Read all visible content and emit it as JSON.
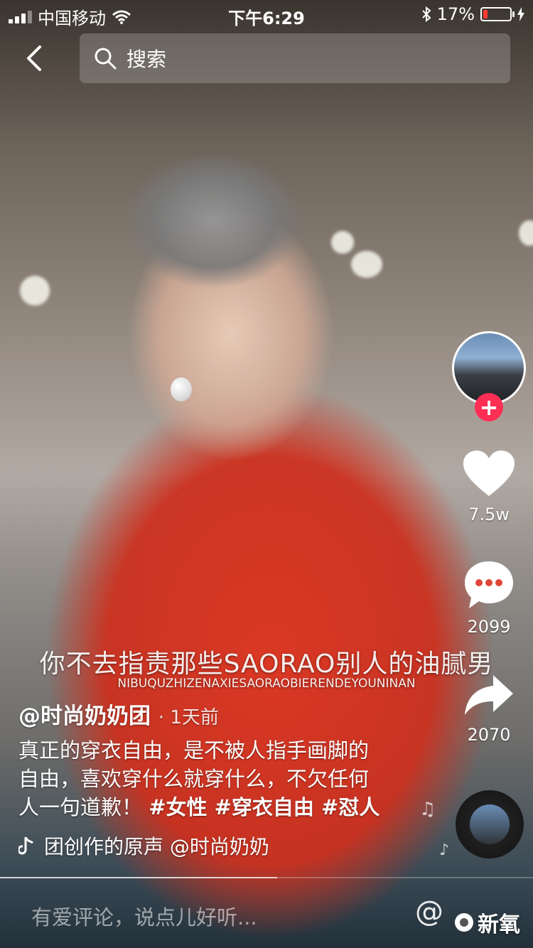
{
  "status_bar": {
    "carrier": "中国移动",
    "time": "下午6:29",
    "battery_percent": "17%",
    "battery_level": 0.17
  },
  "search": {
    "placeholder": "搜索"
  },
  "actions": {
    "likes": "7.5w",
    "comments": "2099",
    "shares": "2070"
  },
  "subtitle": {
    "text": "你不去指责那些SAORAO别人的油腻男",
    "pinyin": "NIBUQUZHIZENAXIESAORAOBIERENDEYOUNINAN"
  },
  "post": {
    "author": "@时尚奶奶团",
    "time": "· 1天前",
    "description": "真正的穿衣自由，是不被人指手画脚的自由，喜欢穿什么就穿什么，不欠任何人一句道歉！",
    "tags": "#女性 #穿衣自由 #怼人",
    "music": "团创作的原声    @时尚奶奶"
  },
  "comment_bar": {
    "placeholder": "有爱评论，说点儿好听...",
    "at_symbol": "@"
  },
  "video_progress": 0.52,
  "watermark": "新氧",
  "colors": {
    "follow_button": "#ff2e55",
    "battery_low": "#ff3b30"
  },
  "icons": [
    "back-arrow-icon",
    "search-icon",
    "heart-icon",
    "comment-icon",
    "share-icon",
    "music-note-icon",
    "music-disc-icon",
    "wifi-icon",
    "bluetooth-icon",
    "battery-icon"
  ]
}
